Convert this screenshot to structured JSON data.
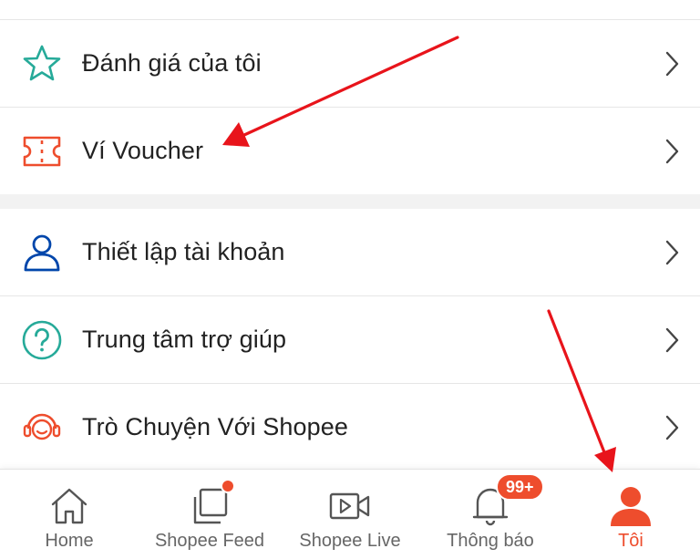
{
  "menu": {
    "items": [
      {
        "label": "Đánh giá của tôi",
        "icon": "star-outline-icon"
      },
      {
        "label": "Ví Voucher",
        "icon": "voucher-ticket-icon"
      },
      {
        "label": "Thiết lập tài khoản",
        "icon": "user-outline-icon"
      },
      {
        "label": "Trung tâm trợ giúp",
        "icon": "help-circle-icon"
      },
      {
        "label": "Trò Chuyện Với Shopee",
        "icon": "headset-chat-icon"
      }
    ]
  },
  "bottom_nav": {
    "items": [
      {
        "label": "Home",
        "icon": "home-icon",
        "active": false
      },
      {
        "label": "Shopee Feed",
        "icon": "feed-icon",
        "active": false
      },
      {
        "label": "Shopee Live",
        "icon": "live-video-icon",
        "active": false
      },
      {
        "label": "Thông báo",
        "icon": "bell-icon",
        "active": false,
        "badge": "99+"
      },
      {
        "label": "Tôi",
        "icon": "user-filled-icon",
        "active": true
      }
    ]
  },
  "colors": {
    "brand": "#ee4d2d",
    "star_icon": "#26aa99",
    "voucher_icon": "#ee4d2d",
    "account_icon": "#0046ab",
    "help_icon": "#26aa99",
    "chat_icon": "#ee4d2d",
    "annotation_arrow": "#e8141b"
  }
}
